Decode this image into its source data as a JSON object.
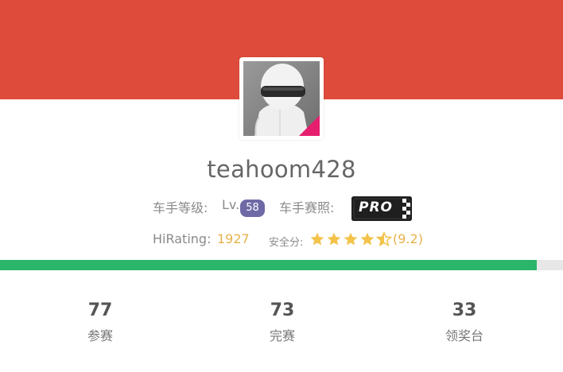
{
  "profile": {
    "username": "teahoom428",
    "avatar_alt": "helmet-avatar"
  },
  "driver_level": {
    "label": "车手等级:",
    "prefix": "Lv.",
    "value": "58"
  },
  "license": {
    "label": "车手赛照:",
    "badge_text": "PRO"
  },
  "rating": {
    "label": "HiRating:",
    "value": "1927"
  },
  "safety": {
    "label": "安全分:",
    "stars_filled": 4,
    "stars_half": 1,
    "score_text": "(9.2)"
  },
  "progress": {
    "fraction": 0.953
  },
  "stats": [
    {
      "value": "77",
      "label": "参赛"
    },
    {
      "value": "73",
      "label": "完赛"
    },
    {
      "value": "33",
      "label": "领奖台"
    }
  ],
  "colors": {
    "banner": "#df4b3a",
    "progress": "#2bb56a",
    "gold": "#e6b24a",
    "level_badge": "#6f6aa6"
  }
}
